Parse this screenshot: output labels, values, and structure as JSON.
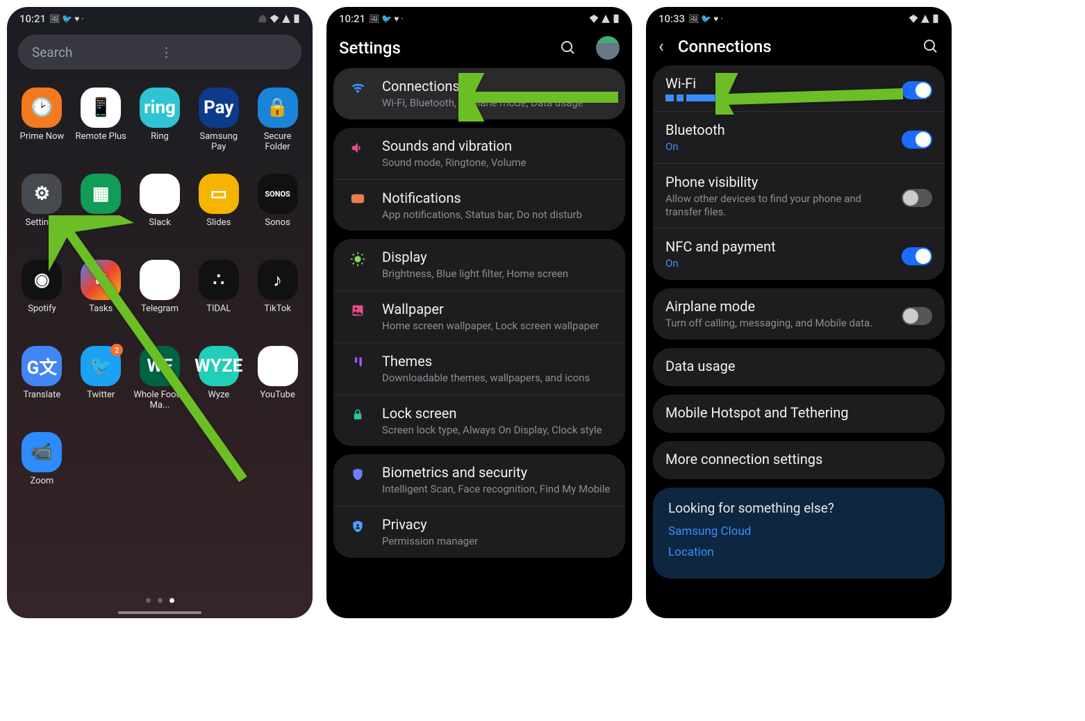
{
  "screen1": {
    "status": {
      "time": "10:21",
      "icons_left": "🖼 🐦 ♥ ·",
      "icons_right": "🔕 📶 📶 🔋"
    },
    "search_placeholder": "Search",
    "apps": [
      {
        "label": "Prime Now",
        "icon": "🕑",
        "bg": "bg-orange"
      },
      {
        "label": "Remote Plus",
        "icon": "📱",
        "bg": "bg-white"
      },
      {
        "label": "Ring",
        "icon": "ring",
        "bg": "bg-teal"
      },
      {
        "label": "Samsung Pay",
        "icon": "Pay",
        "bg": "bg-dblue"
      },
      {
        "label": "Secure Folder",
        "icon": "🔒",
        "bg": "bg-blue"
      },
      {
        "label": "Settings",
        "icon": "⚙",
        "bg": "bg-gray"
      },
      {
        "label": "Sheets",
        "icon": "▦",
        "bg": "bg-green"
      },
      {
        "label": "Slack",
        "icon": "✱",
        "bg": "bg-slack"
      },
      {
        "label": "Slides",
        "icon": "▭",
        "bg": "bg-yellow"
      },
      {
        "label": "Sonos",
        "icon": "SONOS",
        "bg": "bg-black"
      },
      {
        "label": "Spotify",
        "icon": "◉",
        "bg": "bg-spot"
      },
      {
        "label": "Tasks ",
        "icon": "✓",
        "bg": "bg-task"
      },
      {
        "label": "Telegram",
        "icon": "✈",
        "bg": "bg-tel"
      },
      {
        "label": "TIDAL",
        "icon": "∴",
        "bg": "bg-tidal"
      },
      {
        "label": "TikTok",
        "icon": "♪",
        "bg": "bg-tiktok"
      },
      {
        "label": "Translate",
        "icon": "G文",
        "bg": "bg-trans"
      },
      {
        "label": "Twitter",
        "icon": "🐦",
        "bg": "bg-tw",
        "badge": "2"
      },
      {
        "label": "Whole Foods Ma...",
        "icon": "WF",
        "bg": "bg-wf"
      },
      {
        "label": "Wyze",
        "icon": "WYZE",
        "bg": "bg-wyze"
      },
      {
        "label": "YouTube",
        "icon": "▶",
        "bg": "bg-yt"
      },
      {
        "label": "Zoom",
        "icon": "📹",
        "bg": "bg-zoom"
      }
    ]
  },
  "screen2": {
    "status": {
      "time": "10:21",
      "icons_left": "🖼 🐦 ♥ ·"
    },
    "title": "Settings",
    "groups": [
      {
        "rows": [
          {
            "icon": "wifi",
            "title": "Connections",
            "sub": "Wi-Fi, Bluetooth, Airplane mode, Data usage",
            "hl": true
          }
        ]
      },
      {
        "rows": [
          {
            "icon": "sound",
            "title": "Sounds and vibration",
            "sub": "Sound mode, Ringtone, Volume"
          },
          {
            "icon": "notif",
            "title": "Notifications",
            "sub": "App notifications, Status bar, Do not disturb"
          }
        ]
      },
      {
        "rows": [
          {
            "icon": "display",
            "title": "Display",
            "sub": "Brightness, Blue light filter, Home screen"
          },
          {
            "icon": "wall",
            "title": "Wallpaper",
            "sub": "Home screen wallpaper, Lock screen wallpaper"
          },
          {
            "icon": "theme",
            "title": "Themes",
            "sub": "Downloadable themes, wallpapers, and icons"
          },
          {
            "icon": "lock",
            "title": "Lock screen",
            "sub": "Screen lock type, Always On Display, Clock style"
          }
        ]
      },
      {
        "rows": [
          {
            "icon": "shield",
            "title": "Biometrics and security",
            "sub": "Intelligent Scan, Face recognition, Find My Mobile"
          },
          {
            "icon": "priv",
            "title": "Privacy",
            "sub": "Permission manager"
          }
        ]
      }
    ]
  },
  "screen3": {
    "status": {
      "time": "10:33",
      "icons_left": "🖼 🐦 ♥ ·"
    },
    "title": "Connections",
    "groups": [
      {
        "rows": [
          {
            "title": "Wi-Fi",
            "sub_redacted": true,
            "toggle": "on"
          },
          {
            "title": "Bluetooth",
            "sub": "On",
            "sub_blue": true,
            "toggle": "on"
          },
          {
            "title": "Phone visibility",
            "sub": "Allow other devices to find your phone and transfer files.",
            "toggle": "off"
          },
          {
            "title": "NFC and payment",
            "sub": "On",
            "sub_blue": true,
            "toggle": "on"
          }
        ]
      },
      {
        "rows": [
          {
            "title": "Airplane mode",
            "sub": "Turn off calling, messaging, and Mobile data.",
            "toggle": "off"
          }
        ]
      },
      {
        "rows": [
          {
            "title": "Data usage"
          }
        ]
      },
      {
        "rows": [
          {
            "title": "Mobile Hotspot and Tethering"
          }
        ]
      },
      {
        "rows": [
          {
            "title": "More connection settings"
          }
        ]
      }
    ],
    "footer": {
      "title": "Looking for something else?",
      "links": [
        "Samsung Cloud",
        "Location"
      ]
    }
  }
}
